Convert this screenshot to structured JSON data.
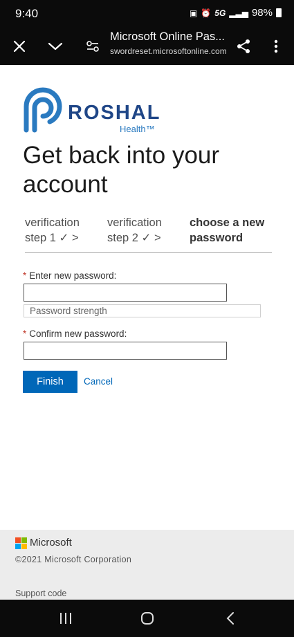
{
  "status": {
    "time": "9:40",
    "network": "5G",
    "battery": "98%"
  },
  "toolbar": {
    "page_title": "Microsoft Online Pas...",
    "url": "swordreset.microsoftonline.com"
  },
  "logo": {
    "word": "ROSHAL",
    "sub": "Health™"
  },
  "page": {
    "title": "Get back into your account",
    "steps": [
      {
        "line1": "verification",
        "line2": "step 1 ✓ >"
      },
      {
        "line1": "verification",
        "line2": "step 2 ✓ >"
      },
      {
        "line1": "choose a new",
        "line2": "password"
      }
    ]
  },
  "form": {
    "required_marker": "*",
    "new_password_label": "Enter new password:",
    "new_password_value": "",
    "strength_label": "Password strength",
    "confirm_password_label": "Confirm new password:",
    "confirm_password_value": "",
    "finish_label": "Finish",
    "cancel_label": "Cancel"
  },
  "footer": {
    "brand": "Microsoft",
    "copyright": "©2021 Microsoft Corporation",
    "support": "Support code"
  },
  "colors": {
    "accent": "#0067b8",
    "brand_dark": "#1f4687",
    "brand_light": "#2a7ac0",
    "required": "#c0392b",
    "ms_red": "#f25022",
    "ms_green": "#7fba00",
    "ms_blue": "#00a4ef",
    "ms_yellow": "#ffb900"
  },
  "icons": [
    "close-icon",
    "chevron-down-icon",
    "page-settings-icon",
    "share-icon",
    "more-vert-icon",
    "recents-icon",
    "home-icon",
    "back-icon"
  ]
}
